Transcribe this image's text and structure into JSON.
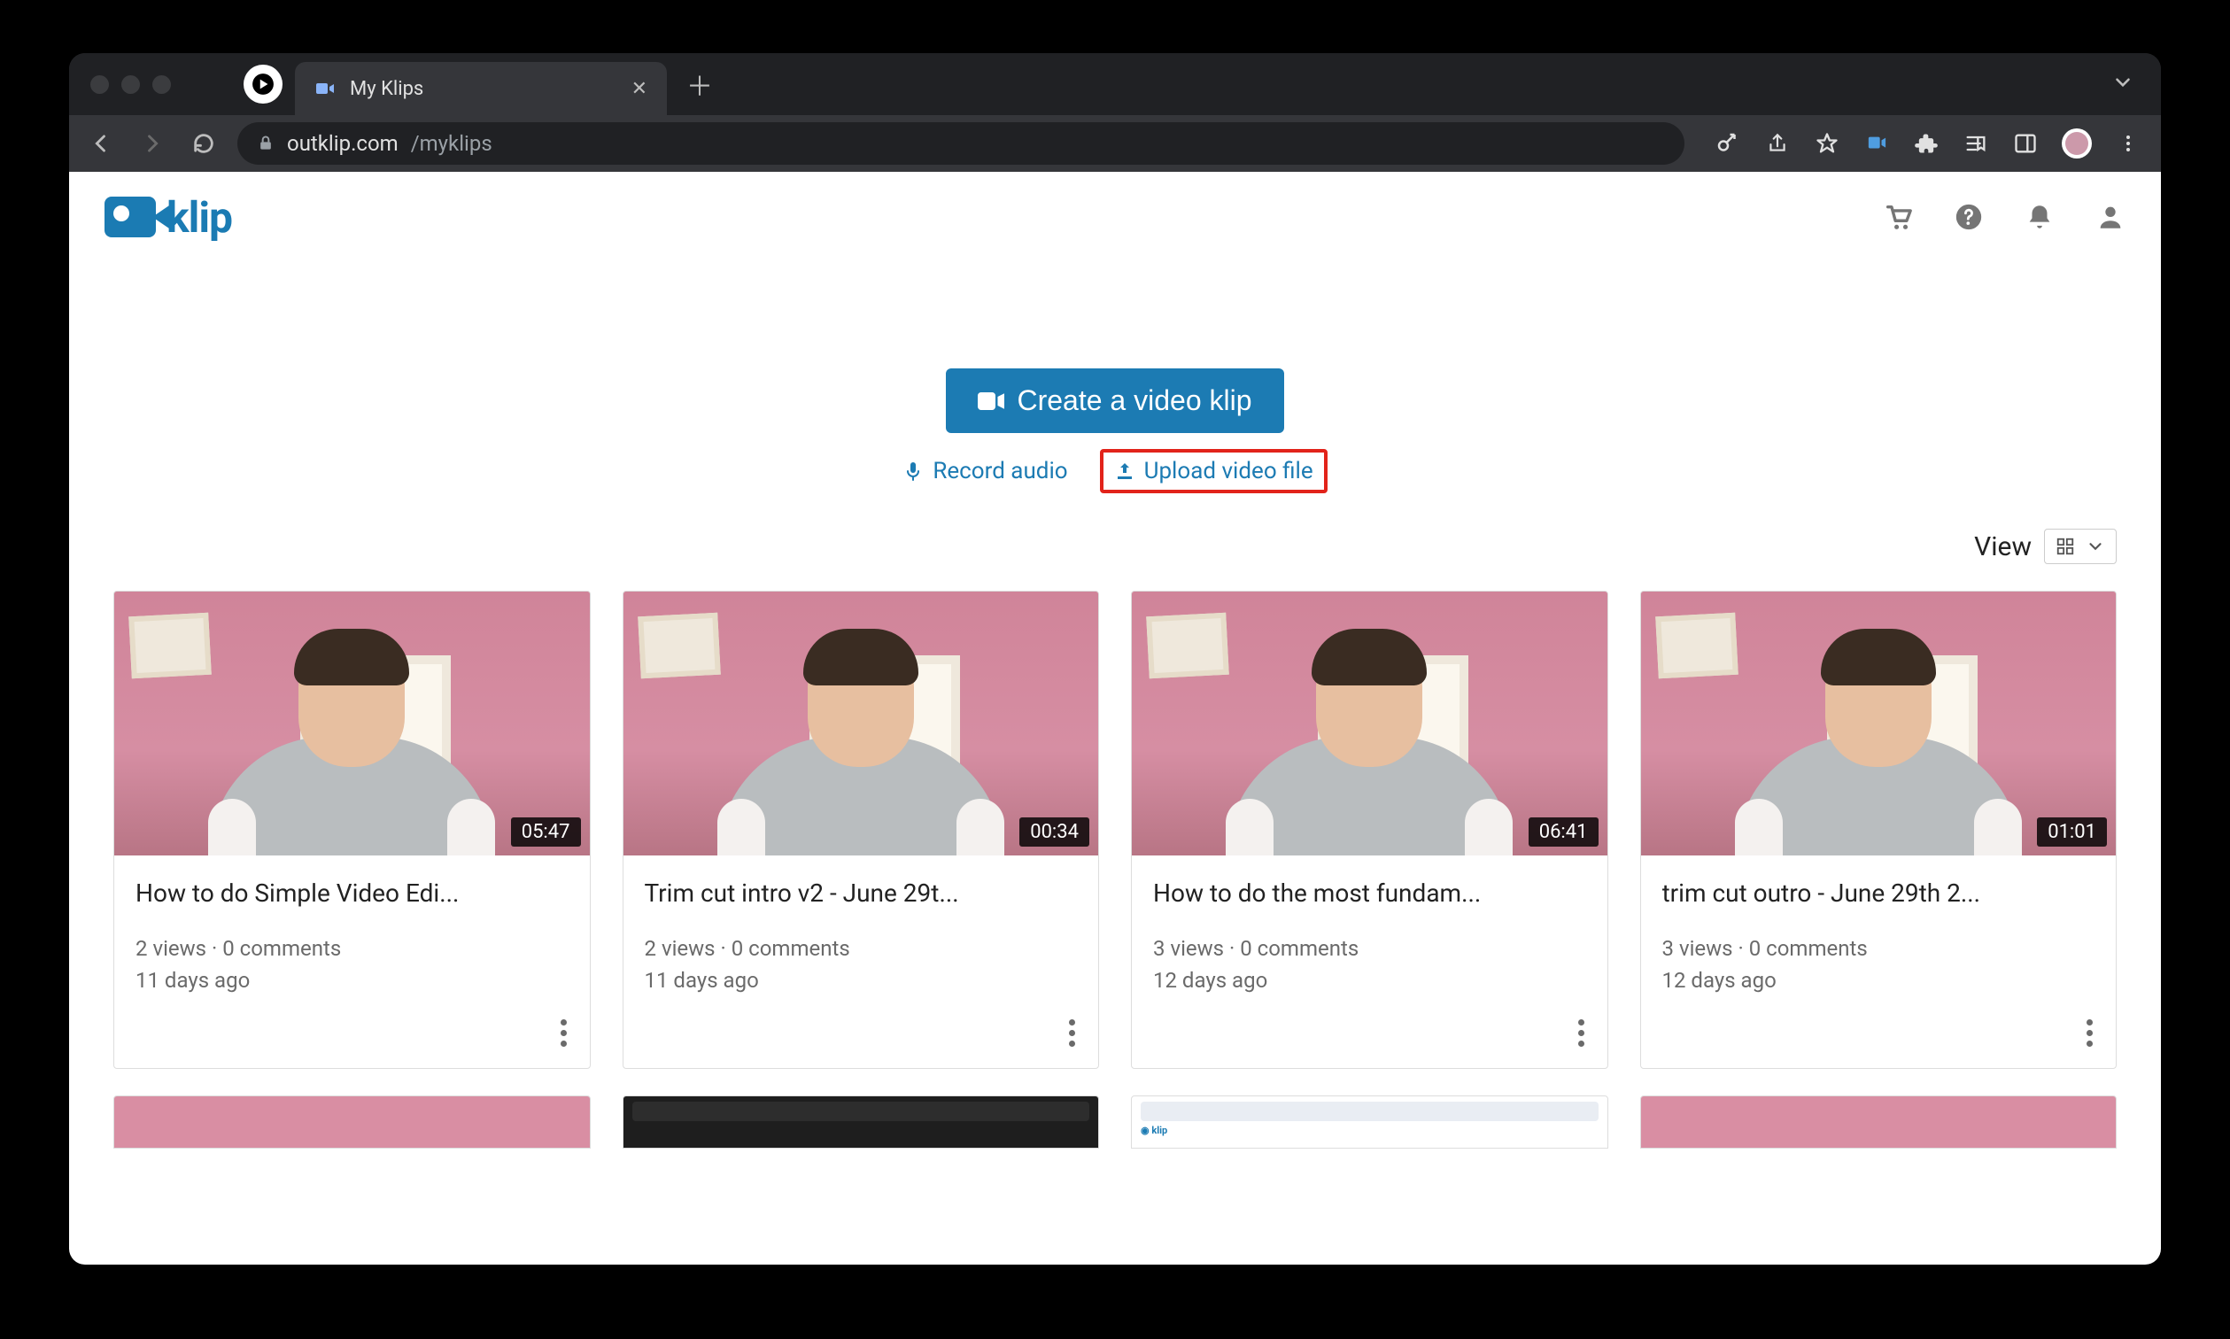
{
  "browser": {
    "tab_title": "My Klips",
    "url_host": "outklip.com",
    "url_path": "/myklips"
  },
  "app": {
    "logo_text": "klip",
    "create_button": "Create a video klip",
    "record_audio": "Record audio",
    "upload_video": "Upload video file",
    "view_label": "View"
  },
  "cards": [
    {
      "title": "How to do Simple Video Edi...",
      "duration": "05:47",
      "meta_line1": "2 views · 0 comments",
      "meta_line2": "11 days ago"
    },
    {
      "title": "Trim cut intro v2 - June 29t...",
      "duration": "00:34",
      "meta_line1": "2 views · 0 comments",
      "meta_line2": "11 days ago"
    },
    {
      "title": "How to do the most fundam...",
      "duration": "06:41",
      "meta_line1": "3 views · 0 comments",
      "meta_line2": "12 days ago"
    },
    {
      "title": "trim cut outro - June 29th 2...",
      "duration": "01:01",
      "meta_line1": "3 views · 0 comments",
      "meta_line2": "12 days ago"
    }
  ]
}
